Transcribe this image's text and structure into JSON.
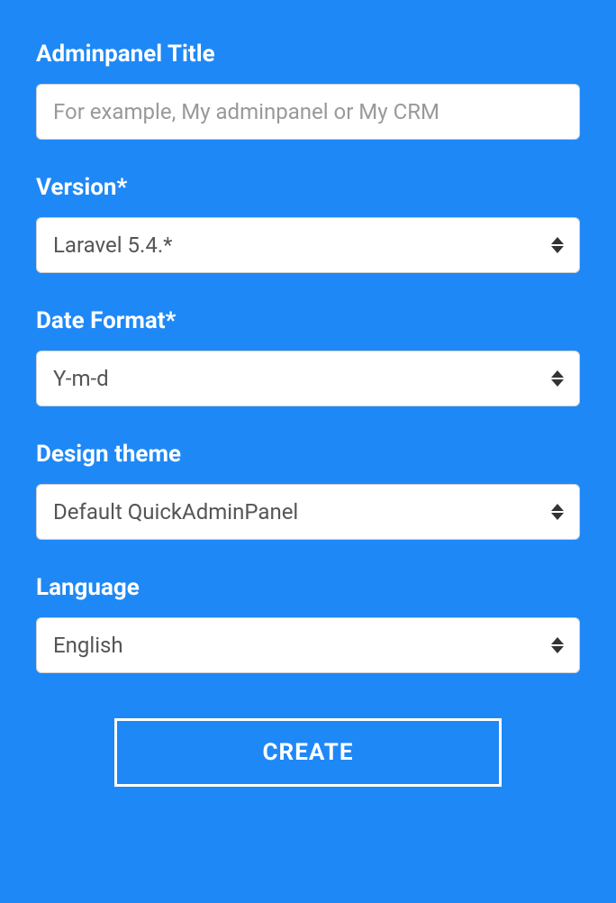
{
  "form": {
    "title": {
      "label": "Adminpanel Title",
      "placeholder": "For example, My adminpanel or My CRM",
      "value": ""
    },
    "version": {
      "label": "Version*",
      "value": "Laravel 5.4.*"
    },
    "dateFormat": {
      "label": "Date Format*",
      "value": "Y-m-d"
    },
    "designTheme": {
      "label": "Design theme",
      "value": "Default QuickAdminPanel"
    },
    "language": {
      "label": "Language",
      "value": "English"
    },
    "submitButton": "CREATE"
  }
}
